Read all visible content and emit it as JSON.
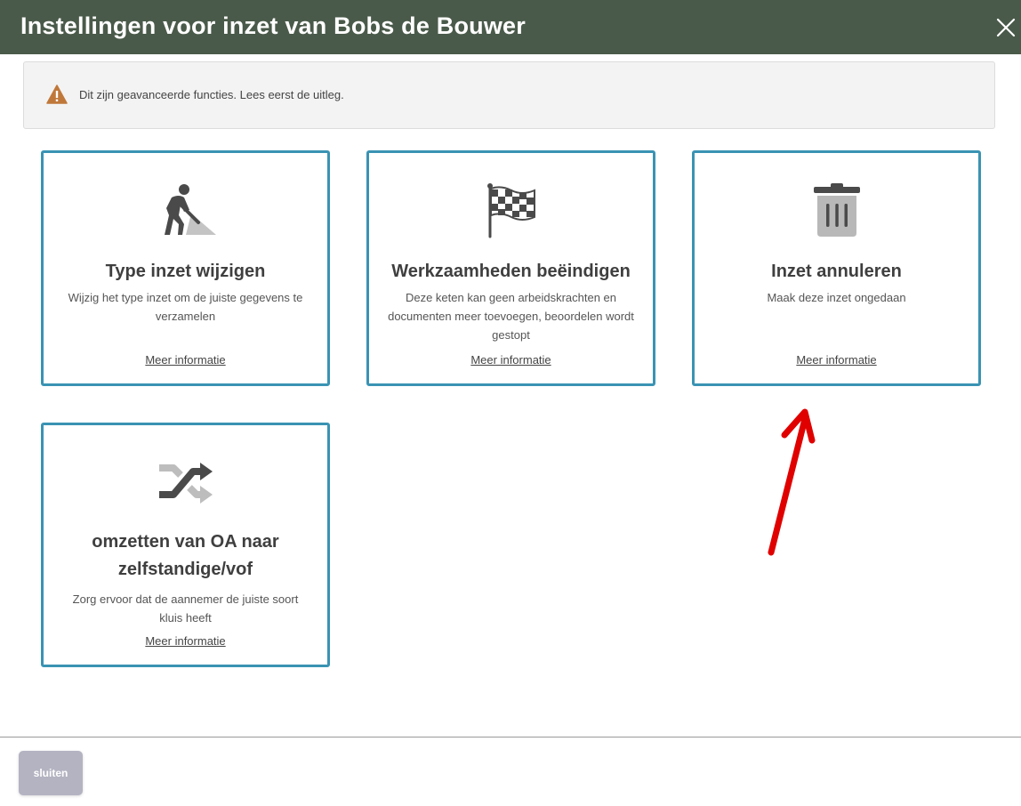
{
  "header": {
    "title": "Instellingen voor inzet van Bobs de Bouwer",
    "close_icon": "close-icon"
  },
  "warning": {
    "icon": "warning-triangle-icon",
    "text": "Dit zijn geavanceerde functies. Lees eerst de uitleg."
  },
  "cards": [
    {
      "icon": "construction-worker-icon",
      "title": "Type inzet wijzigen",
      "description": "Wijzig het type inzet om de juiste gegevens te verzamelen",
      "link": "Meer informatie"
    },
    {
      "icon": "checkered-flag-icon",
      "title": "Werkzaamheden beëindigen",
      "description": "Deze keten kan geen arbeidskrachten en documenten meer toevoegen, beoordelen wordt gestopt",
      "link": "Meer informatie"
    },
    {
      "icon": "trash-icon",
      "title": "Inzet annuleren",
      "description": "Maak deze inzet ongedaan",
      "link": "Meer informatie"
    },
    {
      "icon": "shuffle-icon",
      "title": "omzetten van OA naar zelfstandige/vof",
      "description": "Zorg ervoor dat de aannemer de juiste soort kluis heeft",
      "link": "Meer informatie"
    }
  ],
  "footer": {
    "close_label": "sluiten"
  },
  "colors": {
    "header_bg": "#4a5a4a",
    "card_border": "#3a93b3",
    "warning_icon": "#c0783a",
    "annotation_arrow": "#e00000",
    "close_button_bg": "#b3b3c2"
  }
}
